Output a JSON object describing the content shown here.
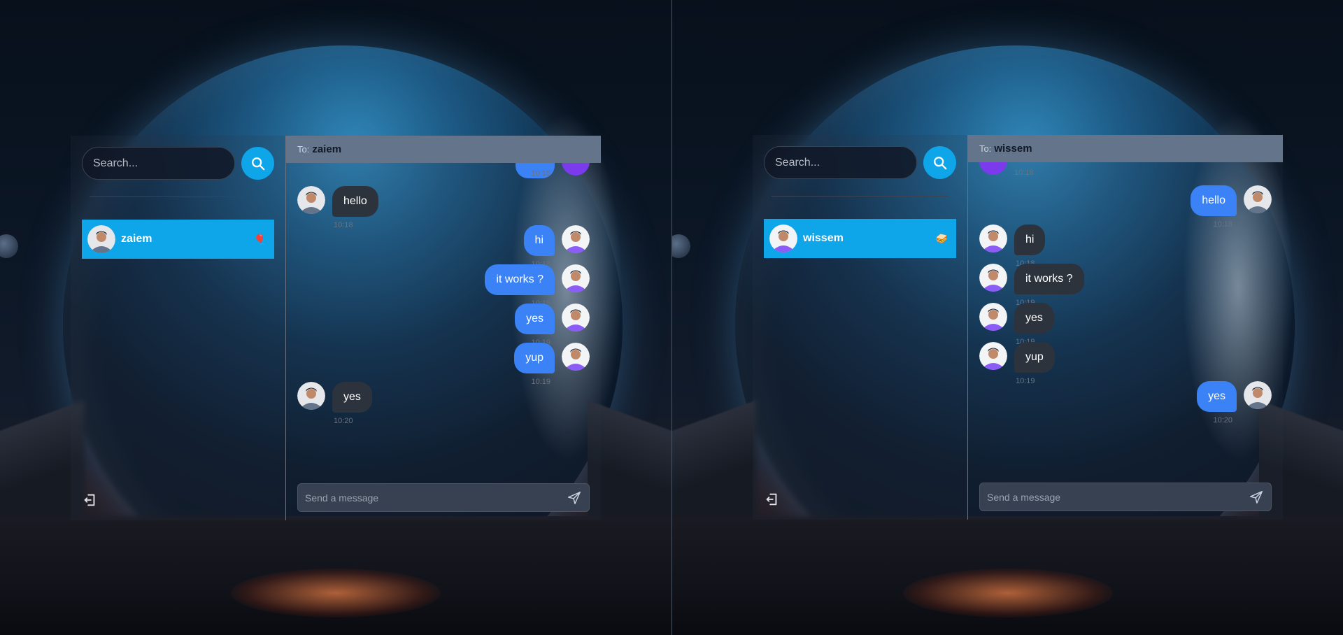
{
  "left": {
    "search": {
      "placeholder": "Search..."
    },
    "contact": {
      "name": "zaiem",
      "emoji": "🎈"
    },
    "chat": {
      "to_label": "To:",
      "to_name": "zaiem",
      "partial_time": "10:18",
      "messages": [
        {
          "dir": "in",
          "text": "hello",
          "time": "10:18"
        },
        {
          "dir": "out",
          "text": "hi",
          "time": "10:18"
        },
        {
          "dir": "out",
          "text": "it works ?",
          "time": "10:19"
        },
        {
          "dir": "out",
          "text": "yes",
          "time": "10:19"
        },
        {
          "dir": "out",
          "text": "yup",
          "time": "10:19"
        },
        {
          "dir": "in",
          "text": "yes",
          "time": "10:20"
        }
      ],
      "composer_placeholder": "Send a message"
    }
  },
  "right": {
    "search": {
      "placeholder": "Search..."
    },
    "contact": {
      "name": "wissem",
      "emoji": "🥪"
    },
    "chat": {
      "to_label": "To:",
      "to_name": "wissem",
      "partial_time": "10:18",
      "messages": [
        {
          "dir": "out",
          "text": "hello",
          "time": "10:18"
        },
        {
          "dir": "in",
          "text": "hi",
          "time": "10:18"
        },
        {
          "dir": "in",
          "text": "it works ?",
          "time": "10:19"
        },
        {
          "dir": "in",
          "text": "yes",
          "time": "10:19"
        },
        {
          "dir": "in",
          "text": "yup",
          "time": "10:19"
        },
        {
          "dir": "out",
          "text": "yes",
          "time": "10:20"
        }
      ],
      "composer_placeholder": "Send a message"
    }
  },
  "colors": {
    "accent": "#0ea5e9",
    "outgoing_bubble": "#3b82f6",
    "incoming_bubble": "#2d333d",
    "header": "#64748b"
  },
  "icons": {
    "search": "search-icon",
    "logout": "logout-icon",
    "send": "send-icon"
  }
}
